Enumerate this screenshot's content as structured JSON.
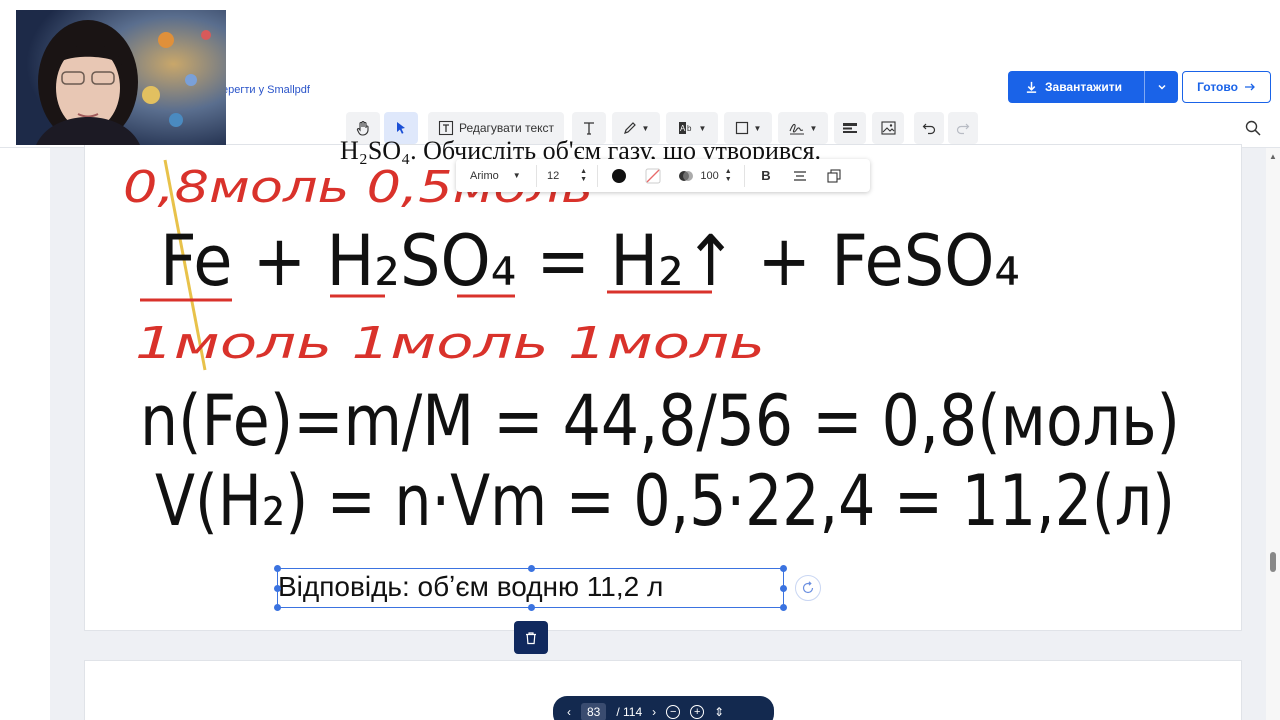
{
  "header": {
    "save_note": "ерегти у Smallpdf",
    "download_label": "Завантажити",
    "done_label": "Готово"
  },
  "toolbar": {
    "edit_text_label": "Редагувати текст"
  },
  "format_bar": {
    "font": "Arimo",
    "size": "12",
    "opacity": "100",
    "bold_label": "B"
  },
  "document": {
    "printed_top": "H₂SO₄. Обчисліть об'єм газу, що утворився.",
    "handwriting": {
      "amounts": "0,8моль 0,5моль",
      "equation": "Fe + H₂SO₄ = H₂↑ + FeSO₄",
      "moles": "1моль  1моль  1моль",
      "line1": "n(Fe)=m/M = 44,8/56 = 0,8(моль)",
      "line2": "V(H₂) = n·Vm = 0,5·22,4 = 11,2(л)"
    },
    "answer_text": "Відповідь:   обʼєм водню 11,2 л"
  },
  "pager": {
    "current_page": "83",
    "total_pages": "/ 114"
  },
  "colors": {
    "accent": "#1a63e8",
    "handwriting_red": "#d9322b",
    "pager_bg": "#13294f"
  }
}
